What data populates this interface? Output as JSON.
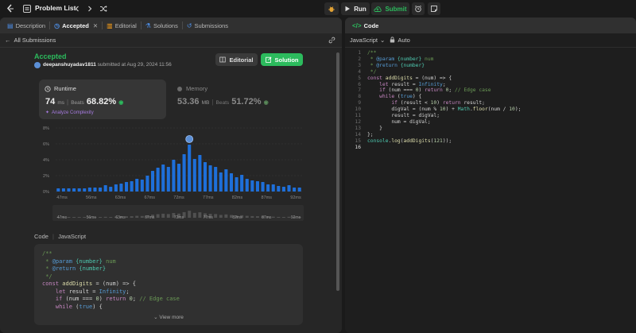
{
  "topbar": {
    "problem_list": "Problem List",
    "run_label": "Run",
    "submit_label": "Submit"
  },
  "left_tabs": [
    {
      "label": "Description"
    },
    {
      "label": "Accepted"
    },
    {
      "label": "Editorial"
    },
    {
      "label": "Solutions"
    },
    {
      "label": "Submissions"
    }
  ],
  "subbar": {
    "back_label": "All Submissions"
  },
  "result": {
    "status": "Accepted",
    "username": "deepanshuyadav1811",
    "submitted_text": "submitted at Aug 29, 2024 11:56",
    "editorial_btn": "Editorial",
    "solution_btn": "Solution"
  },
  "runtime": {
    "label": "Runtime",
    "value": "74",
    "unit": "ms",
    "beats_label": "Beats",
    "beats_value": "68.82%",
    "analyze": "Analyze Complexity"
  },
  "memory": {
    "label": "Memory",
    "value": "53.36",
    "unit": "MB",
    "beats_label": "Beats",
    "beats_value": "51.72%"
  },
  "chart_data": {
    "type": "bar",
    "yticks": [
      "8%",
      "6%",
      "4%",
      "2%",
      "0%"
    ],
    "ylim": [
      0,
      8
    ],
    "xticks": [
      "47ms",
      "56ms",
      "63ms",
      "67ms",
      "72ms",
      "77ms",
      "82ms",
      "87ms",
      "92ms"
    ],
    "values": [
      0.4,
      0.4,
      0.4,
      0.4,
      0.4,
      0.4,
      0.5,
      0.5,
      0.5,
      0.8,
      0.6,
      0.9,
      1.0,
      1.2,
      1.3,
      1.6,
      1.5,
      2.0,
      2.6,
      3.0,
      3.4,
      3.1,
      4.0,
      3.5,
      4.7,
      5.9,
      4.1,
      4.6,
      3.7,
      3.3,
      3.1,
      2.4,
      2.8,
      2.3,
      1.8,
      2.1,
      1.6,
      1.4,
      1.3,
      1.2,
      0.9,
      0.9,
      0.7,
      0.6,
      0.8,
      0.5,
      0.5
    ],
    "highlight_index": 25,
    "mini_ticks": [
      "47ms",
      "56ms",
      "63ms",
      "67ms",
      "72ms",
      "77ms",
      "82ms",
      "87ms",
      "92ms"
    ]
  },
  "code_section": {
    "title": "Code",
    "lang": "JavaScript",
    "view_more": "View more"
  },
  "snippet": [
    "/**",
    " * @param {number} num",
    " * @return {number}",
    " */",
    "const addDigits = (num) => {",
    "    let result = Infinity;",
    "    if (num === 0) return 0; // Edge case",
    "    while (true) {"
  ],
  "editor": {
    "tab_label": "Code",
    "lang": "JavaScript",
    "mode": "Auto",
    "line_numbers": [
      "1",
      "2",
      "3",
      "4",
      "5",
      "6",
      "7",
      "8",
      "9",
      "10",
      "11",
      "12",
      "13",
      "14",
      "15",
      "16"
    ],
    "lines": [
      "/**",
      " * @param {number} num",
      " * @return {number}",
      " */",
      "const addDigits = (num) => {",
      "    let result = Infinity;",
      "    if (num === 0) return 0; // Edge case",
      "    while (true) {",
      "        if (result < 10) return result;",
      "        digVal = (num % 10) + Math.floor(num / 10);",
      "        result = digVal;",
      "        num = digVal;",
      "    }",
      "};",
      "console.log(addDigits(121));",
      ""
    ]
  },
  "colors": {
    "accent_green": "#2cbb5d",
    "bar_blue": "#1e6fd9",
    "brand_orange": "#ffa116"
  }
}
